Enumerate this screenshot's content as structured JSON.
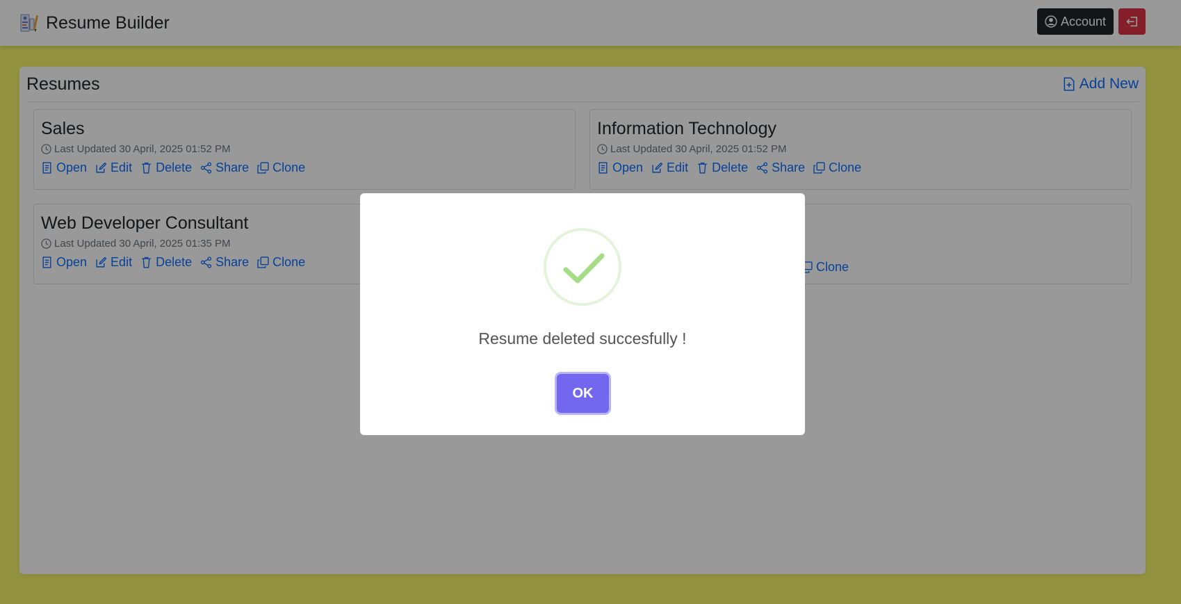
{
  "navbar": {
    "brand_title": "Resume Builder",
    "account_label": "Account",
    "logo_icon": "resume-builder-logo-icon",
    "logout_icon": "logout-icon"
  },
  "main": {
    "title": "Resumes",
    "add_new_label": "Add New",
    "resumes": [
      {
        "title": "Sales",
        "updated": "Last Updated 30 April, 2025 01:52 PM",
        "actions": [
          "Open",
          "Edit",
          "Delete",
          "Share",
          "Clone"
        ]
      },
      {
        "title": "Information Technology",
        "updated": "Last Updated 30 April, 2025 01:52 PM",
        "actions": [
          "Open",
          "Edit",
          "Delete",
          "Share",
          "Clone"
        ]
      },
      {
        "title": "Web Developer Consultant",
        "updated": "Last Updated 30 April, 2025 01:35 PM",
        "actions": [
          "Open",
          "Edit",
          "Delete",
          "Share",
          "Clone"
        ]
      },
      {
        "title": "",
        "updated": "",
        "actions": [
          "Clone"
        ]
      }
    ]
  },
  "modal": {
    "message": "Resume deleted succesfully !",
    "ok_label": "OK",
    "icon": "success-check-icon"
  },
  "colors": {
    "background": "#f4f46a",
    "link": "#0d6efd",
    "danger": "#dc3545",
    "dark": "#212529",
    "confirm": "#7367f0",
    "success": "#a5dc86"
  }
}
